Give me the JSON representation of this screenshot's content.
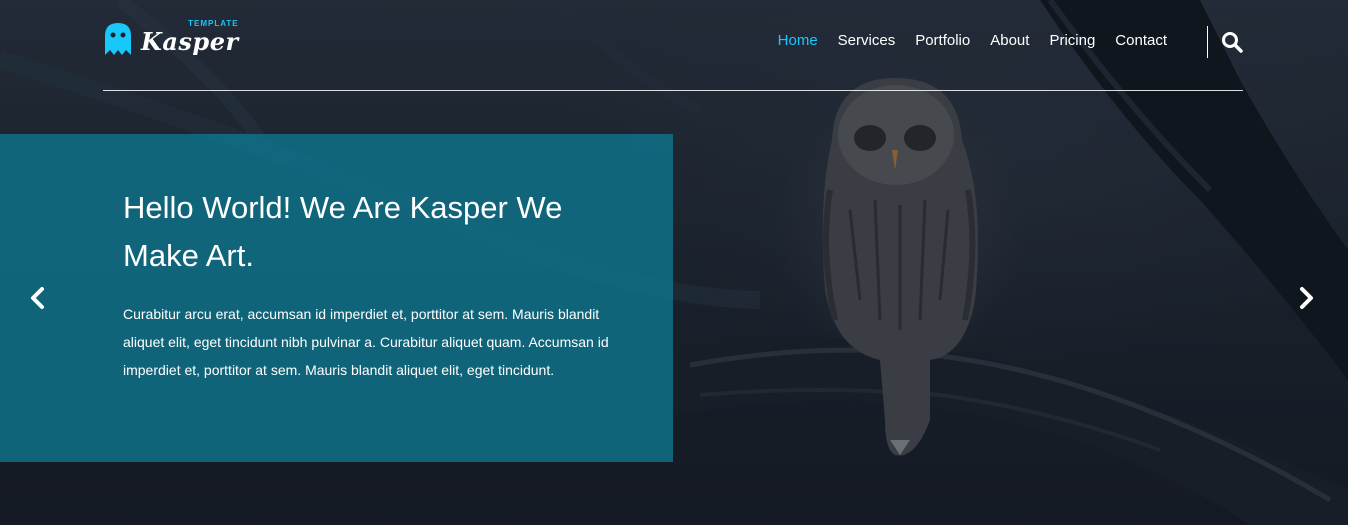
{
  "brand": {
    "name": "Kasper",
    "tagline": "TEMPLATE",
    "accent_color": "#19c8fa",
    "logo_icon": "ghost-icon"
  },
  "nav": {
    "links": [
      {
        "label": "Home",
        "active": true
      },
      {
        "label": "Services",
        "active": false
      },
      {
        "label": "Portfolio",
        "active": false
      },
      {
        "label": "About",
        "active": false
      },
      {
        "label": "Pricing",
        "active": false
      },
      {
        "label": "Contact",
        "active": false
      }
    ],
    "search_icon": "search-icon"
  },
  "hero": {
    "title": "Hello World! We Are Kasper We Make Art.",
    "text": "Curabitur arcu erat, accumsan id imperdiet et, porttitor at sem. Mauris blandit aliquet elit, eget tincidunt nibh pulvinar a. Curabitur aliquet quam. Accumsan id imperdiet et, porttitor at sem. Mauris blandit aliquet elit, eget tincidunt.",
    "box_color": "#0f748c",
    "prev_icon": "chevron-left-icon",
    "next_icon": "chevron-right-icon"
  }
}
